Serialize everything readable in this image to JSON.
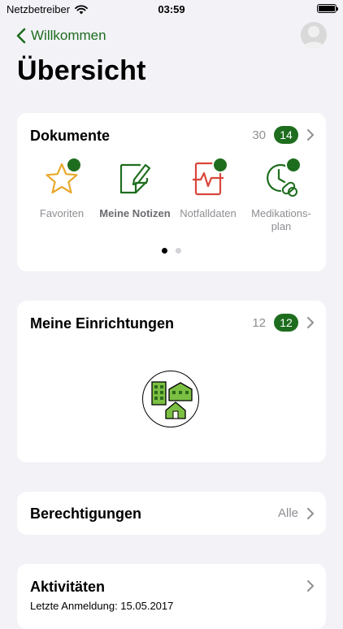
{
  "status": {
    "carrier": "Netzbetreiber",
    "time": "03:59"
  },
  "nav": {
    "back_label": "Willkommen"
  },
  "title": "Übersicht",
  "documents": {
    "title": "Dokumente",
    "count": "30",
    "badge": "14",
    "items": [
      {
        "label": "Favoriten",
        "icon": "star-icon",
        "color": "#e8a92b"
      },
      {
        "label": "Meine Notizen",
        "icon": "note-edit-icon",
        "color": "#1e6d1e"
      },
      {
        "label": "Notfalldaten",
        "icon": "emergency-data-icon",
        "color": "#d9463a"
      },
      {
        "label": "Medikations-plan",
        "icon": "medication-clock-icon",
        "color": "#1e6d1e"
      }
    ],
    "page_count": 2,
    "active_page": 1
  },
  "facilities": {
    "title": "Meine Einrichtungen",
    "count": "12",
    "badge": "12"
  },
  "permissions": {
    "title": "Berechtigungen",
    "value": "Alle"
  },
  "activities": {
    "title": "Aktivitäten",
    "last_login": "Letzte Anmeldung: 15.05.2017"
  },
  "colors": {
    "accent": "#1e6d1e",
    "background": "#f2f2f7"
  }
}
